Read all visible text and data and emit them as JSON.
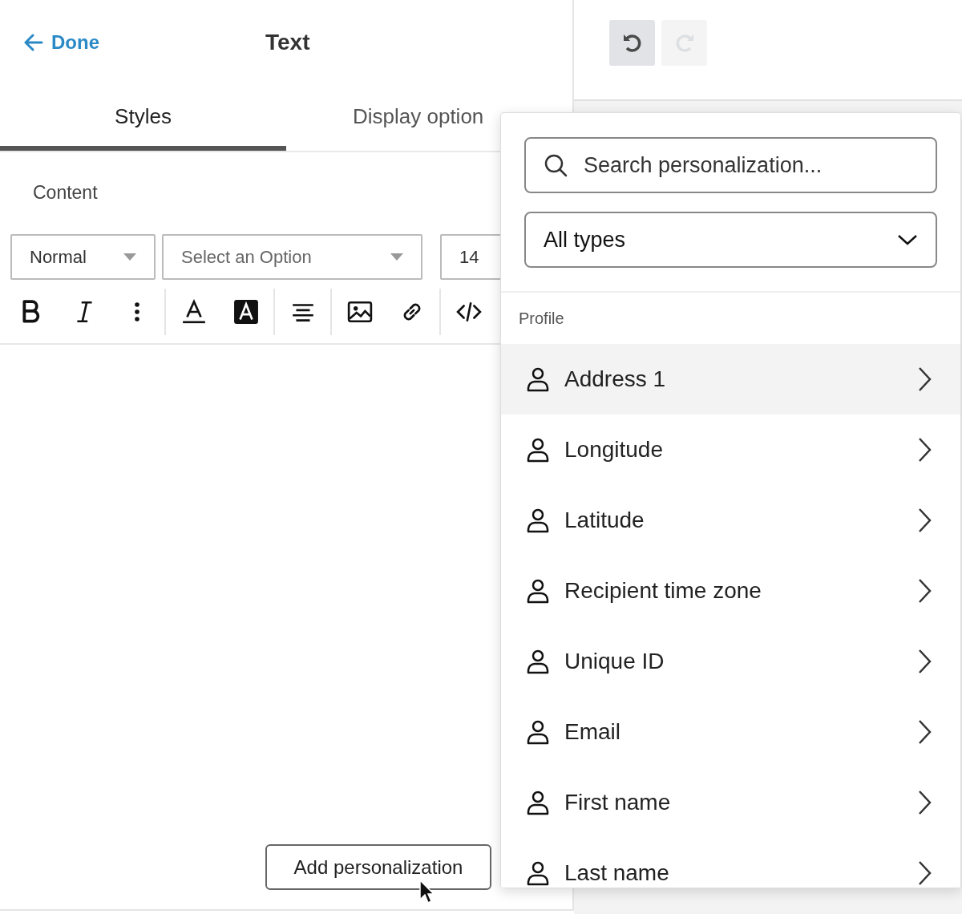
{
  "header": {
    "back_label": "Done",
    "title": "Text"
  },
  "history_buttons": [
    {
      "kind": "undo",
      "disabled": false
    },
    {
      "kind": "redo",
      "disabled": true
    }
  ],
  "tabs": [
    {
      "label": "Styles",
      "selected": true
    },
    {
      "label": "Display option",
      "selected": false
    }
  ],
  "section_label": "Content",
  "format_controls": [
    {
      "kind": "select",
      "value": "Normal"
    },
    {
      "kind": "select",
      "placeholder": "Select an Option"
    },
    {
      "kind": "input",
      "value": "14"
    }
  ],
  "add_button": "Add personalization",
  "personalization_menu": {
    "search": {
      "placeholder": "Search personalization..."
    },
    "type_filter": {
      "value": "All types"
    },
    "group_label": "Profile",
    "items": [
      {
        "label": "Address 1",
        "highlighted": true
      },
      {
        "label": "Longitude",
        "highlighted": false
      },
      {
        "label": "Latitude",
        "highlighted": false
      },
      {
        "label": "Recipient time zone",
        "highlighted": false
      },
      {
        "label": "Unique ID",
        "highlighted": false
      },
      {
        "label": "Email",
        "highlighted": false
      },
      {
        "label": "First name",
        "highlighted": false
      },
      {
        "label": "Last name",
        "highlighted": false
      }
    ]
  }
}
